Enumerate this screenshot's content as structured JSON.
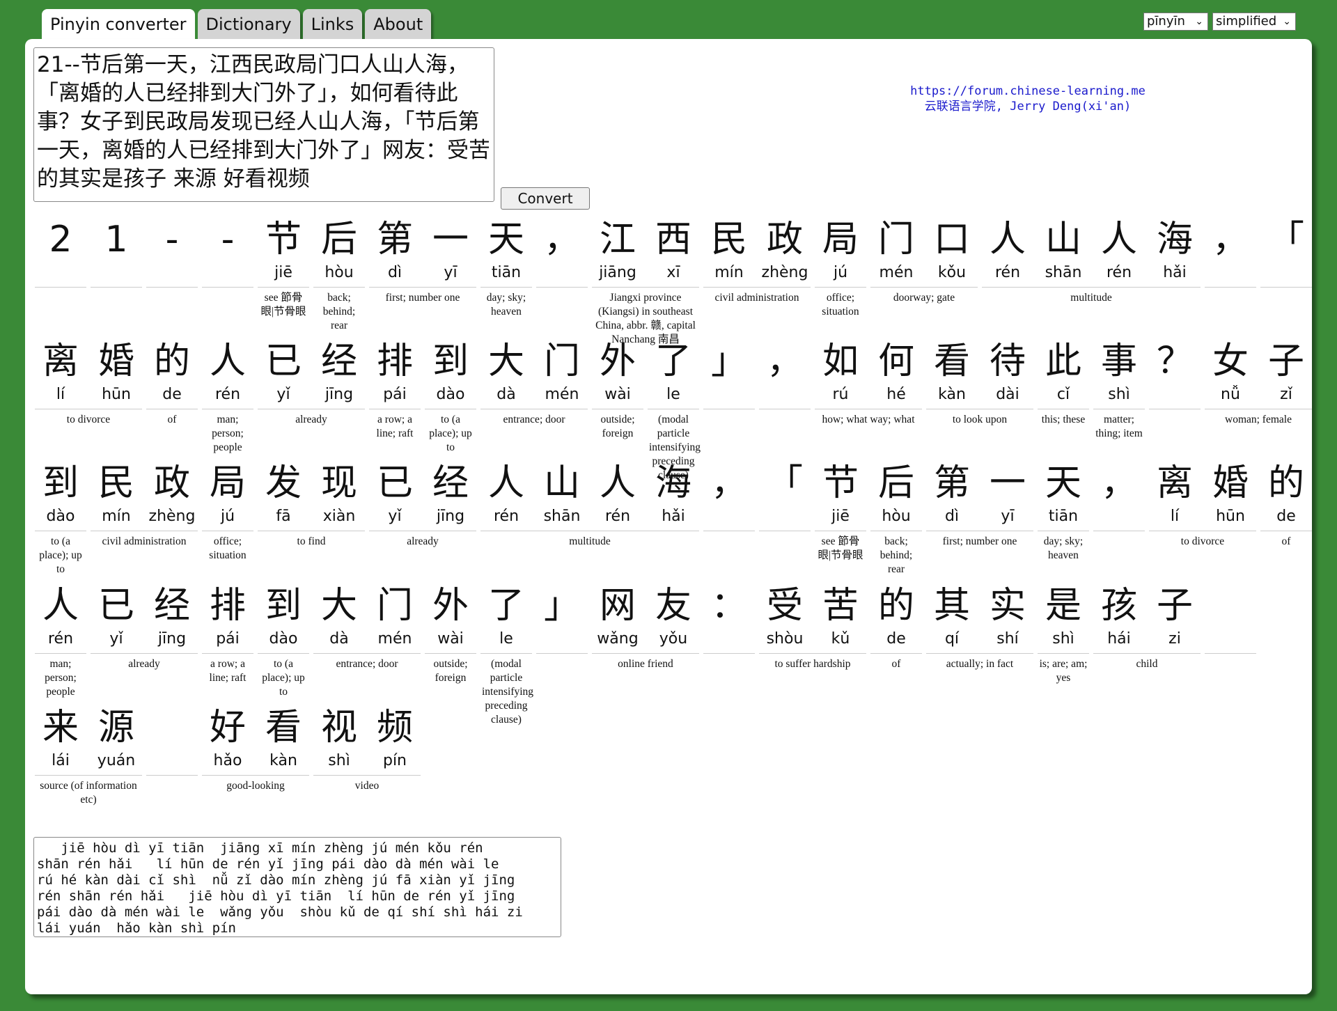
{
  "tabs": [
    "Pinyin converter",
    "Dictionary",
    "Links",
    "About"
  ],
  "selects": {
    "tone": "pīnyīn",
    "script": "simplified",
    "arrow": "⌄"
  },
  "input_text": "21--节后第一天，江西民政局门口人山人海，「离婚的人已经排到大门外了」，如何看待此事？女子到民政局发现已经人山人海，「节后第一天，离婚的人已经排到大门外了」网友：受苦的其实是孩子 来源 好看视频",
  "convert_label": "Convert",
  "credit": {
    "url": "https://forum.chinese-learning.me",
    "name": "云联语言学院, Jerry Deng(xi'an)"
  },
  "rows": [
    {
      "chars": [
        {
          "c": "2",
          "p": ""
        },
        {
          "c": "1",
          "p": ""
        },
        {
          "c": "-",
          "p": ""
        },
        {
          "c": "-",
          "p": ""
        },
        {
          "c": "节",
          "p": "jiē"
        },
        {
          "c": "后",
          "p": "hòu"
        },
        {
          "c": "第",
          "p": "dì"
        },
        {
          "c": "一",
          "p": "yī"
        },
        {
          "c": "天",
          "p": "tiān"
        },
        {
          "c": "，",
          "p": ""
        },
        {
          "c": "江",
          "p": "jiāng"
        },
        {
          "c": "西",
          "p": "xī"
        },
        {
          "c": "民",
          "p": "mín"
        },
        {
          "c": "政",
          "p": "zhèng"
        },
        {
          "c": "局",
          "p": "jú"
        },
        {
          "c": "门",
          "p": "mén"
        },
        {
          "c": "口",
          "p": "kǒu"
        },
        {
          "c": "人",
          "p": "rén"
        },
        {
          "c": "山",
          "p": "shān"
        },
        {
          "c": "人",
          "p": "rén"
        },
        {
          "c": "海",
          "p": "hǎi"
        },
        {
          "c": "，",
          "p": ""
        },
        {
          "c": "「",
          "p": ""
        }
      ],
      "defs": [
        {
          "s": 0,
          "n": 1,
          "t": ""
        },
        {
          "s": 1,
          "n": 1,
          "t": ""
        },
        {
          "s": 2,
          "n": 1,
          "t": ""
        },
        {
          "s": 3,
          "n": 1,
          "t": ""
        },
        {
          "s": 4,
          "n": 1,
          "t": "see 節骨眼|节骨眼"
        },
        {
          "s": 5,
          "n": 1,
          "t": "back; behind; rear"
        },
        {
          "s": 6,
          "n": 2,
          "t": "first; number one"
        },
        {
          "s": 8,
          "n": 1,
          "t": "day; sky; heaven"
        },
        {
          "s": 9,
          "n": 1,
          "t": ""
        },
        {
          "s": 10,
          "n": 2,
          "t": "Jiangxi province (Kiangsi) in southeast China, abbr. 赣, capital Nanchang 南昌"
        },
        {
          "s": 12,
          "n": 2,
          "t": "civil administration"
        },
        {
          "s": 14,
          "n": 1,
          "t": "office; situation"
        },
        {
          "s": 15,
          "n": 2,
          "t": "doorway; gate"
        },
        {
          "s": 17,
          "n": 4,
          "t": "multitude"
        },
        {
          "s": 21,
          "n": 1,
          "t": ""
        },
        {
          "s": 22,
          "n": 1,
          "t": ""
        }
      ]
    },
    {
      "chars": [
        {
          "c": "离",
          "p": "lí"
        },
        {
          "c": "婚",
          "p": "hūn"
        },
        {
          "c": "的",
          "p": "de"
        },
        {
          "c": "人",
          "p": "rén"
        },
        {
          "c": "已",
          "p": "yǐ"
        },
        {
          "c": "经",
          "p": "jīng"
        },
        {
          "c": "排",
          "p": "pái"
        },
        {
          "c": "到",
          "p": "dào"
        },
        {
          "c": "大",
          "p": "dà"
        },
        {
          "c": "门",
          "p": "mén"
        },
        {
          "c": "外",
          "p": "wài"
        },
        {
          "c": "了",
          "p": "le"
        },
        {
          "c": "」",
          "p": ""
        },
        {
          "c": "，",
          "p": ""
        },
        {
          "c": "如",
          "p": "rú"
        },
        {
          "c": "何",
          "p": "hé"
        },
        {
          "c": "看",
          "p": "kàn"
        },
        {
          "c": "待",
          "p": "dài"
        },
        {
          "c": "此",
          "p": "cǐ"
        },
        {
          "c": "事",
          "p": "shì"
        },
        {
          "c": "？",
          "p": ""
        },
        {
          "c": "女",
          "p": "nǚ"
        },
        {
          "c": "子",
          "p": "zǐ"
        }
      ],
      "defs": [
        {
          "s": 0,
          "n": 2,
          "t": "to divorce"
        },
        {
          "s": 2,
          "n": 1,
          "t": "of"
        },
        {
          "s": 3,
          "n": 1,
          "t": "man; person; people"
        },
        {
          "s": 4,
          "n": 2,
          "t": "already"
        },
        {
          "s": 6,
          "n": 1,
          "t": "a row; a line; raft"
        },
        {
          "s": 7,
          "n": 1,
          "t": "to (a place); up to"
        },
        {
          "s": 8,
          "n": 2,
          "t": "entrance; door"
        },
        {
          "s": 10,
          "n": 1,
          "t": "outside; foreign"
        },
        {
          "s": 11,
          "n": 1,
          "t": "(modal particle intensifying preceding clause)"
        },
        {
          "s": 12,
          "n": 1,
          "t": ""
        },
        {
          "s": 13,
          "n": 1,
          "t": ""
        },
        {
          "s": 14,
          "n": 2,
          "t": "how; what way; what"
        },
        {
          "s": 16,
          "n": 2,
          "t": "to look upon"
        },
        {
          "s": 18,
          "n": 1,
          "t": "this; these"
        },
        {
          "s": 19,
          "n": 1,
          "t": "matter; thing; item"
        },
        {
          "s": 20,
          "n": 1,
          "t": ""
        },
        {
          "s": 21,
          "n": 2,
          "t": "woman; female"
        }
      ]
    },
    {
      "chars": [
        {
          "c": "到",
          "p": "dào"
        },
        {
          "c": "民",
          "p": "mín"
        },
        {
          "c": "政",
          "p": "zhèng"
        },
        {
          "c": "局",
          "p": "jú"
        },
        {
          "c": "发",
          "p": "fā"
        },
        {
          "c": "现",
          "p": "xiàn"
        },
        {
          "c": "已",
          "p": "yǐ"
        },
        {
          "c": "经",
          "p": "jīng"
        },
        {
          "c": "人",
          "p": "rén"
        },
        {
          "c": "山",
          "p": "shān"
        },
        {
          "c": "人",
          "p": "rén"
        },
        {
          "c": "海",
          "p": "hǎi"
        },
        {
          "c": "，",
          "p": ""
        },
        {
          "c": "「",
          "p": ""
        },
        {
          "c": "节",
          "p": "jiē"
        },
        {
          "c": "后",
          "p": "hòu"
        },
        {
          "c": "第",
          "p": "dì"
        },
        {
          "c": "一",
          "p": "yī"
        },
        {
          "c": "天",
          "p": "tiān"
        },
        {
          "c": "，",
          "p": ""
        },
        {
          "c": "离",
          "p": "lí"
        },
        {
          "c": "婚",
          "p": "hūn"
        },
        {
          "c": "的",
          "p": "de"
        }
      ],
      "defs": [
        {
          "s": 0,
          "n": 1,
          "t": "to (a place); up to"
        },
        {
          "s": 1,
          "n": 2,
          "t": "civil administration"
        },
        {
          "s": 3,
          "n": 1,
          "t": "office; situation"
        },
        {
          "s": 4,
          "n": 2,
          "t": "to find"
        },
        {
          "s": 6,
          "n": 2,
          "t": "already"
        },
        {
          "s": 8,
          "n": 4,
          "t": "multitude"
        },
        {
          "s": 12,
          "n": 1,
          "t": ""
        },
        {
          "s": 13,
          "n": 1,
          "t": ""
        },
        {
          "s": 14,
          "n": 1,
          "t": "see 節骨眼|节骨眼"
        },
        {
          "s": 15,
          "n": 1,
          "t": "back; behind; rear"
        },
        {
          "s": 16,
          "n": 2,
          "t": "first; number one"
        },
        {
          "s": 18,
          "n": 1,
          "t": "day; sky; heaven"
        },
        {
          "s": 19,
          "n": 1,
          "t": ""
        },
        {
          "s": 20,
          "n": 2,
          "t": "to divorce"
        },
        {
          "s": 22,
          "n": 1,
          "t": "of"
        }
      ]
    },
    {
      "chars": [
        {
          "c": "人",
          "p": "rén"
        },
        {
          "c": "已",
          "p": "yǐ"
        },
        {
          "c": "经",
          "p": "jīng"
        },
        {
          "c": "排",
          "p": "pái"
        },
        {
          "c": "到",
          "p": "dào"
        },
        {
          "c": "大",
          "p": "dà"
        },
        {
          "c": "门",
          "p": "mén"
        },
        {
          "c": "外",
          "p": "wài"
        },
        {
          "c": "了",
          "p": "le"
        },
        {
          "c": "」",
          "p": ""
        },
        {
          "c": "网",
          "p": "wǎng"
        },
        {
          "c": "友",
          "p": "yǒu"
        },
        {
          "c": "：",
          "p": ""
        },
        {
          "c": "受",
          "p": "shòu"
        },
        {
          "c": "苦",
          "p": "kǔ"
        },
        {
          "c": "的",
          "p": "de"
        },
        {
          "c": "其",
          "p": "qí"
        },
        {
          "c": "实",
          "p": "shí"
        },
        {
          "c": "是",
          "p": "shì"
        },
        {
          "c": "孩",
          "p": "hái"
        },
        {
          "c": "子",
          "p": "zi"
        },
        {
          "c": " ",
          "p": ""
        }
      ],
      "defs": [
        {
          "s": 0,
          "n": 1,
          "t": "man; person; people"
        },
        {
          "s": 1,
          "n": 2,
          "t": "already"
        },
        {
          "s": 3,
          "n": 1,
          "t": "a row; a line; raft"
        },
        {
          "s": 4,
          "n": 1,
          "t": "to (a place); up to"
        },
        {
          "s": 5,
          "n": 2,
          "t": "entrance; door"
        },
        {
          "s": 7,
          "n": 1,
          "t": "outside; foreign"
        },
        {
          "s": 8,
          "n": 1,
          "t": "(modal particle intensifying preceding clause)"
        },
        {
          "s": 9,
          "n": 1,
          "t": ""
        },
        {
          "s": 10,
          "n": 2,
          "t": "online friend"
        },
        {
          "s": 12,
          "n": 1,
          "t": ""
        },
        {
          "s": 13,
          "n": 2,
          "t": "to suffer hardship"
        },
        {
          "s": 15,
          "n": 1,
          "t": "of"
        },
        {
          "s": 16,
          "n": 2,
          "t": "actually; in fact"
        },
        {
          "s": 18,
          "n": 1,
          "t": "is; are; am; yes"
        },
        {
          "s": 19,
          "n": 2,
          "t": "child"
        },
        {
          "s": 21,
          "n": 1,
          "t": ""
        }
      ]
    },
    {
      "chars": [
        {
          "c": "来",
          "p": "lái"
        },
        {
          "c": "源",
          "p": "yuán"
        },
        {
          "c": " ",
          "p": ""
        },
        {
          "c": "好",
          "p": "hǎo"
        },
        {
          "c": "看",
          "p": "kàn"
        },
        {
          "c": "视",
          "p": "shì"
        },
        {
          "c": "频",
          "p": "pín"
        }
      ],
      "defs": [
        {
          "s": 0,
          "n": 2,
          "t": "source (of information etc)"
        },
        {
          "s": 2,
          "n": 1,
          "t": ""
        },
        {
          "s": 3,
          "n": 2,
          "t": "good-looking"
        },
        {
          "s": 5,
          "n": 2,
          "t": "video"
        }
      ]
    }
  ],
  "output_text": "   jiē hòu dì yī tiān  jiāng xī mín zhèng jú mén kǒu rén\nshān rén hǎi   lí hūn de rén yǐ jīng pái dào dà mén wài le\nrú hé kàn dài cǐ shì  nǚ zǐ dào mín zhèng jú fā xiàn yǐ jīng\nrén shān rén hǎi   jiē hòu dì yī tiān  lí hūn de rén yǐ jīng\npái dào dà mén wài le  wǎng yǒu  shòu kǔ de qí shí shì hái zi\nlái yuán  hǎo kàn shì pín"
}
